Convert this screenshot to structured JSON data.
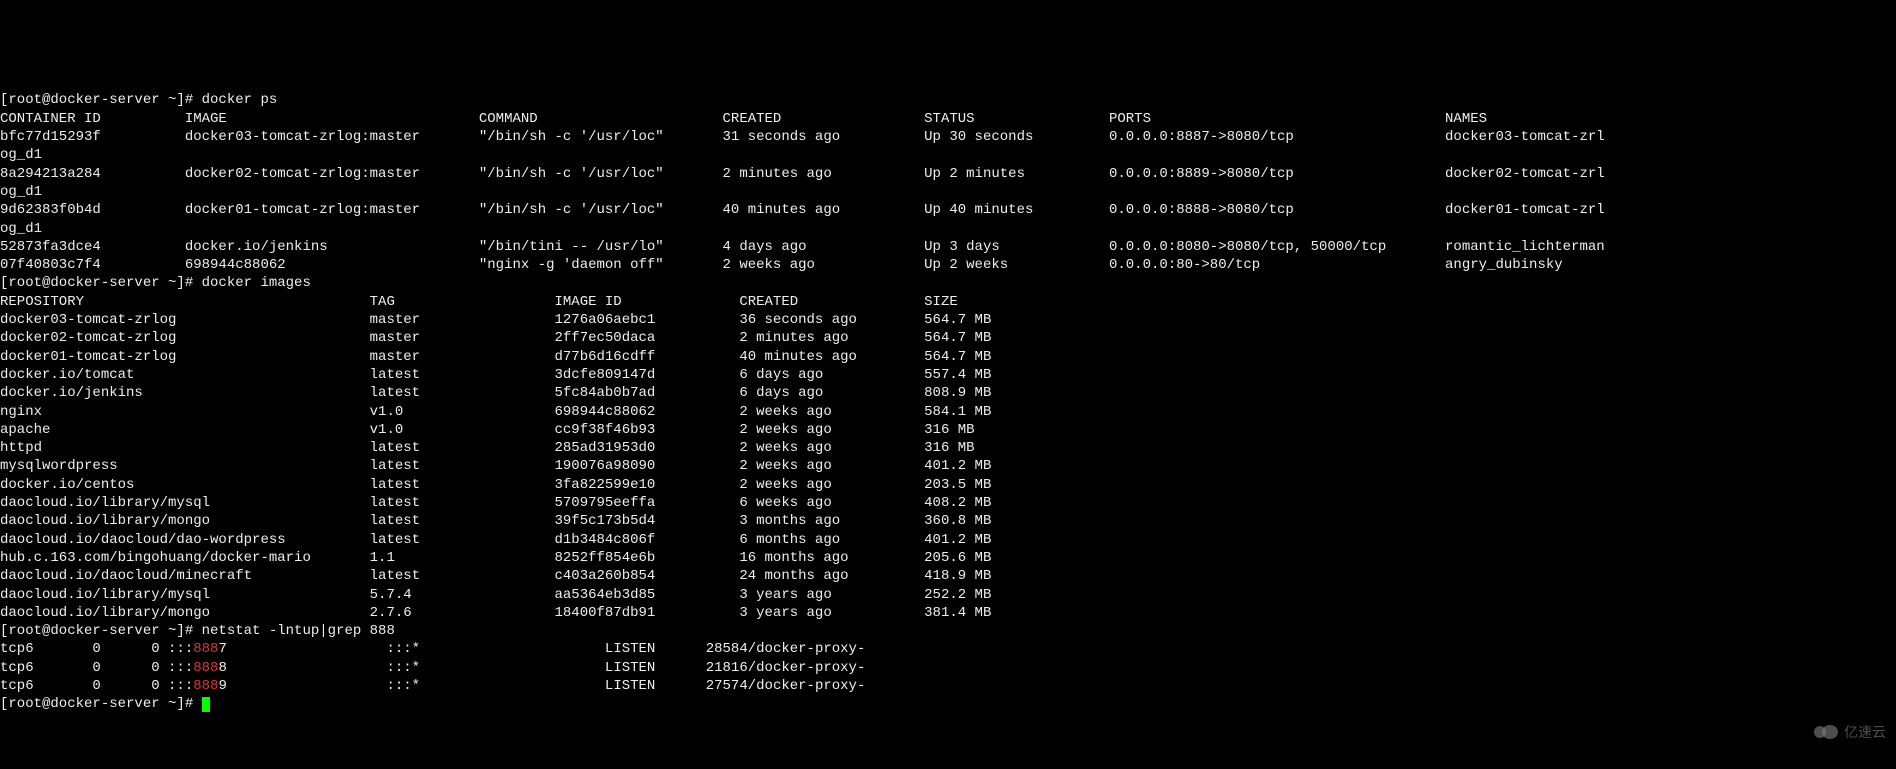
{
  "prompt": "[root@docker-server ~]# ",
  "cmd_ps": "docker ps",
  "cmd_images": "docker images",
  "cmd_netstat": "netstat -lntup|grep 888",
  "ps_headers": {
    "id": "CONTAINER ID",
    "image": "IMAGE",
    "command": "COMMAND",
    "created": "CREATED",
    "status": "STATUS",
    "ports": "PORTS",
    "names": "NAMES"
  },
  "ps_rows": [
    {
      "id": "bfc77d15293f",
      "image": "docker03-tomcat-zrlog:master",
      "command": "\"/bin/sh -c '/usr/loc\"",
      "created": "31 seconds ago",
      "status": "Up 30 seconds",
      "ports": "0.0.0.0:8887->8080/tcp",
      "names": "docker03-tomcat-zrl",
      "nameext": "og_d1"
    },
    {
      "id": "8a294213a284",
      "image": "docker02-tomcat-zrlog:master",
      "command": "\"/bin/sh -c '/usr/loc\"",
      "created": "2 minutes ago",
      "status": "Up 2 minutes",
      "ports": "0.0.0.0:8889->8080/tcp",
      "names": "docker02-tomcat-zrl",
      "nameext": "og_d1"
    },
    {
      "id": "9d62383f0b4d",
      "image": "docker01-tomcat-zrlog:master",
      "command": "\"/bin/sh -c '/usr/loc\"",
      "created": "40 minutes ago",
      "status": "Up 40 minutes",
      "ports": "0.0.0.0:8888->8080/tcp",
      "names": "docker01-tomcat-zrl",
      "nameext": "og_d1"
    },
    {
      "id": "52873fa3dce4",
      "image": "docker.io/jenkins",
      "command": "\"/bin/tini -- /usr/lo\"",
      "created": "4 days ago",
      "status": "Up 3 days",
      "ports": "0.0.0.0:8080->8080/tcp, 50000/tcp",
      "names": "romantic_lichterman",
      "nameext": ""
    },
    {
      "id": "07f40803c7f4",
      "image": "698944c88062",
      "command": "\"nginx -g 'daemon off\"",
      "created": "2 weeks ago",
      "status": "Up 2 weeks",
      "ports": "0.0.0.0:80->80/tcp",
      "names": "angry_dubinsky",
      "nameext": ""
    }
  ],
  "img_headers": {
    "repo": "REPOSITORY",
    "tag": "TAG",
    "id": "IMAGE ID",
    "created": "CREATED",
    "size": "SIZE"
  },
  "img_rows": [
    {
      "repo": "docker03-tomcat-zrlog",
      "tag": "master",
      "id": "1276a06aebc1",
      "created": "36 seconds ago",
      "size": "564.7 MB"
    },
    {
      "repo": "docker02-tomcat-zrlog",
      "tag": "master",
      "id": "2ff7ec50daca",
      "created": "2 minutes ago",
      "size": "564.7 MB"
    },
    {
      "repo": "docker01-tomcat-zrlog",
      "tag": "master",
      "id": "d77b6d16cdff",
      "created": "40 minutes ago",
      "size": "564.7 MB"
    },
    {
      "repo": "docker.io/tomcat",
      "tag": "latest",
      "id": "3dcfe809147d",
      "created": "6 days ago",
      "size": "557.4 MB"
    },
    {
      "repo": "docker.io/jenkins",
      "tag": "latest",
      "id": "5fc84ab0b7ad",
      "created": "6 days ago",
      "size": "808.9 MB"
    },
    {
      "repo": "nginx",
      "tag": "v1.0",
      "id": "698944c88062",
      "created": "2 weeks ago",
      "size": "584.1 MB"
    },
    {
      "repo": "apache",
      "tag": "v1.0",
      "id": "cc9f38f46b93",
      "created": "2 weeks ago",
      "size": "316 MB"
    },
    {
      "repo": "httpd",
      "tag": "latest",
      "id": "285ad31953d0",
      "created": "2 weeks ago",
      "size": "316 MB"
    },
    {
      "repo": "mysqlwordpress",
      "tag": "latest",
      "id": "190076a98090",
      "created": "2 weeks ago",
      "size": "401.2 MB"
    },
    {
      "repo": "docker.io/centos",
      "tag": "latest",
      "id": "3fa822599e10",
      "created": "2 weeks ago",
      "size": "203.5 MB"
    },
    {
      "repo": "daocloud.io/library/mysql",
      "tag": "latest",
      "id": "5709795eeffa",
      "created": "6 weeks ago",
      "size": "408.2 MB"
    },
    {
      "repo": "daocloud.io/library/mongo",
      "tag": "latest",
      "id": "39f5c173b5d4",
      "created": "3 months ago",
      "size": "360.8 MB"
    },
    {
      "repo": "daocloud.io/daocloud/dao-wordpress",
      "tag": "latest",
      "id": "d1b3484c806f",
      "created": "6 months ago",
      "size": "401.2 MB"
    },
    {
      "repo": "hub.c.163.com/bingohuang/docker-mario",
      "tag": "1.1",
      "id": "8252ff854e6b",
      "created": "16 months ago",
      "size": "205.6 MB"
    },
    {
      "repo": "daocloud.io/daocloud/minecraft",
      "tag": "latest",
      "id": "c403a260b854",
      "created": "24 months ago",
      "size": "418.9 MB"
    },
    {
      "repo": "daocloud.io/library/mysql",
      "tag": "5.7.4",
      "id": "aa5364eb3d85",
      "created": "3 years ago",
      "size": "252.2 MB"
    },
    {
      "repo": "daocloud.io/library/mongo",
      "tag": "2.7.6",
      "id": "18400f87db91",
      "created": "3 years ago",
      "size": "381.4 MB"
    }
  ],
  "netstat_rows": [
    {
      "proto": "tcp6",
      "recvq": "0",
      "sendq": "0",
      "local_prefix": ":::",
      "port_hl": "888",
      "port_suffix": "7",
      "foreign": ":::*",
      "state": "LISTEN",
      "program": "28584/docker-proxy-"
    },
    {
      "proto": "tcp6",
      "recvq": "0",
      "sendq": "0",
      "local_prefix": ":::",
      "port_hl": "888",
      "port_suffix": "8",
      "foreign": ":::*",
      "state": "LISTEN",
      "program": "21816/docker-proxy-"
    },
    {
      "proto": "tcp6",
      "recvq": "0",
      "sendq": "0",
      "local_prefix": ":::",
      "port_hl": "888",
      "port_suffix": "9",
      "foreign": ":::*",
      "state": "LISTEN",
      "program": "27574/docker-proxy-"
    }
  ],
  "watermark": "亿速云"
}
